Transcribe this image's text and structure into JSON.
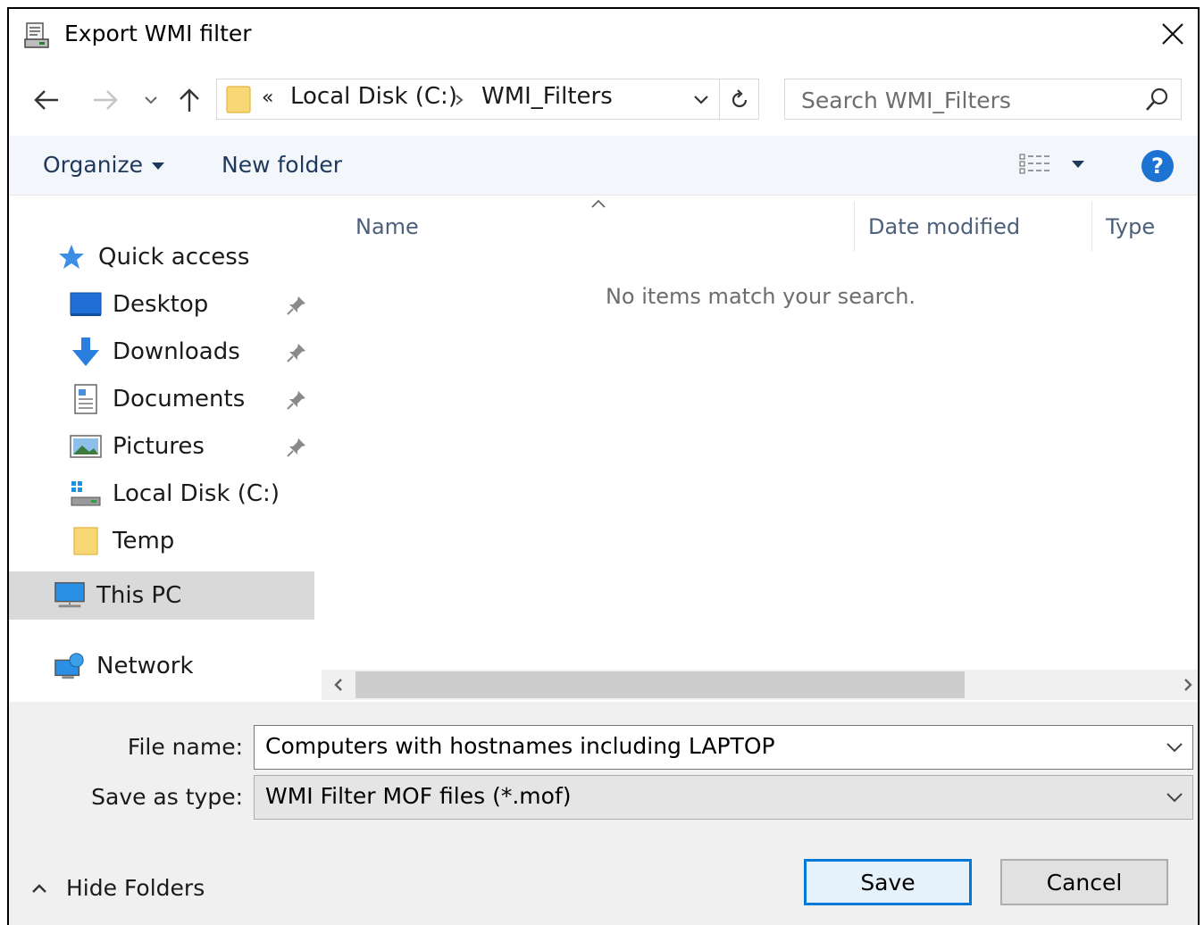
{
  "window": {
    "title": "Export WMI filter",
    "close_icon": "close-icon"
  },
  "nav": {
    "back_icon": "back-arrow-icon",
    "forward_icon": "forward-arrow-icon",
    "recent_icon": "chevron-down-icon",
    "up_icon": "up-arrow-icon",
    "overflow": "«",
    "breadcrumb": [
      "Local Disk (C:)",
      "WMI_Filters"
    ],
    "refresh_icon": "refresh-icon",
    "search_placeholder": "Search WMI_Filters"
  },
  "toolbar": {
    "organize": "Organize",
    "new_folder": "New folder",
    "help": "?"
  },
  "sidebar": {
    "items": [
      {
        "label": "Quick access",
        "icon": "star-icon"
      },
      {
        "label": "Desktop",
        "icon": "desktop-icon",
        "pinned": true
      },
      {
        "label": "Downloads",
        "icon": "downloads-icon",
        "pinned": true
      },
      {
        "label": "Documents",
        "icon": "documents-icon",
        "pinned": true
      },
      {
        "label": "Pictures",
        "icon": "pictures-icon",
        "pinned": true
      },
      {
        "label": "Local Disk (C:)",
        "icon": "drive-icon"
      },
      {
        "label": "Temp",
        "icon": "folder-icon"
      },
      {
        "label": "This PC",
        "icon": "computer-icon",
        "selected": true
      },
      {
        "label": "Network",
        "icon": "network-icon"
      }
    ]
  },
  "list": {
    "columns": [
      "Name",
      "Date modified",
      "Type"
    ],
    "empty_message": "No items match your search."
  },
  "form": {
    "file_name_label": "File name:",
    "file_name_value": "Computers with hostnames including LAPTOP",
    "save_type_label": "Save as type:",
    "save_type_value": "WMI Filter MOF files (*.mof)"
  },
  "footer": {
    "hide_folders": "Hide Folders",
    "save": "Save",
    "cancel": "Cancel"
  },
  "colors": {
    "accent": "#0078d7",
    "toolbar_bg": "#f3f6fb",
    "selected_bg": "#d9d9d9",
    "link_text": "#1e395b"
  }
}
